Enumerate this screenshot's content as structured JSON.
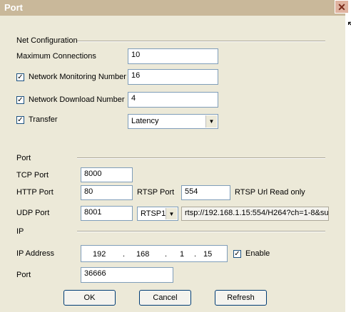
{
  "window": {
    "title": "Port",
    "close_icon": "close-icon"
  },
  "net_config": {
    "group_label": "Net Configuration",
    "max_connections": {
      "label": "Maximum Connections",
      "value": "10"
    },
    "monitoring": {
      "label": "Network Monitoring Number",
      "value": "16",
      "checked": true
    },
    "download": {
      "label": "Network Download Number",
      "value": "4",
      "checked": true
    },
    "transfer": {
      "label": "Transfer",
      "value": "Latency",
      "checked": true
    }
  },
  "port": {
    "group_label": "Port",
    "tcp": {
      "label": "TCP Port",
      "value": "8000"
    },
    "http": {
      "label": "HTTP Port",
      "value": "80"
    },
    "rtsp": {
      "label": "RTSP Port",
      "value": "554",
      "note": "RTSP Url Read only"
    },
    "udp": {
      "label": "UDP Port",
      "value": "8001"
    },
    "rtsp_select": "RTSP1",
    "rtsp_url": "rtsp://192.168.1.15:554/H264?ch=1-8&su"
  },
  "ip": {
    "group_label": "IP",
    "address_label": "IP Address",
    "octets": [
      "192",
      "168",
      "1",
      "15"
    ],
    "dot": ".",
    "enable_label": "Enable",
    "port_label": "Port",
    "port_value": "36666"
  },
  "buttons": {
    "ok": "OK",
    "cancel": "Cancel",
    "refresh": "Refresh"
  },
  "checkmark": "✓",
  "dropdown_arrow": "▼"
}
